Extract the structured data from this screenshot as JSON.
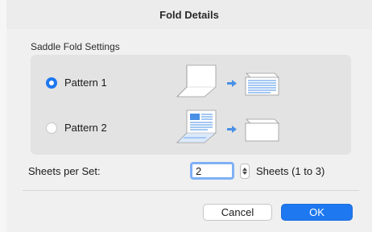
{
  "dialog": {
    "title": "Fold Details"
  },
  "saddle_fold": {
    "group_label": "Saddle Fold Settings",
    "options": [
      {
        "label": "Pattern 1",
        "selected": true
      },
      {
        "label": "Pattern 2",
        "selected": false
      }
    ]
  },
  "sheets": {
    "label": "Sheets per Set:",
    "value": "2",
    "unit_text": "Sheets (1 to 3)"
  },
  "buttons": {
    "cancel": "Cancel",
    "ok": "OK"
  },
  "colors": {
    "accent": "#1e78f0",
    "window_bg": "#ececec",
    "group_bg": "#e3e3e3",
    "illustration_blue": "#4a90e6"
  },
  "icons": {
    "pattern1_before": "folded-sheet-icon",
    "pattern1_arrow": "arrow-right-icon",
    "pattern1_after": "lined-folded-sheet-icon",
    "pattern2_before": "printed-folded-sheet-icon",
    "pattern2_arrow": "arrow-right-icon",
    "pattern2_after": "blank-folded-sheet-icon"
  }
}
